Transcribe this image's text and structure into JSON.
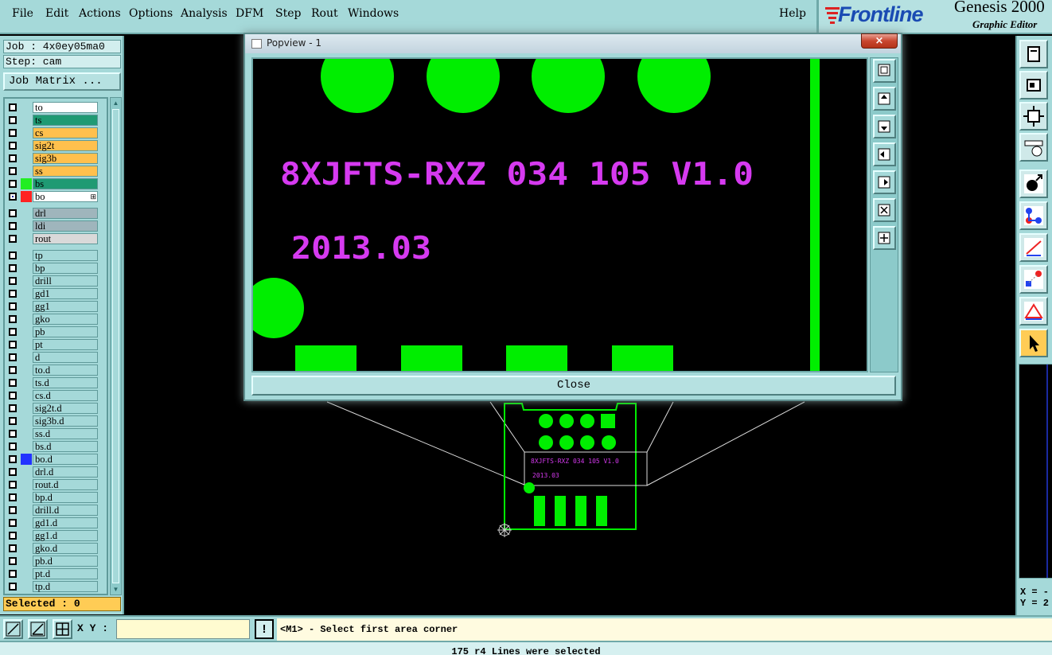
{
  "menu": {
    "file": "File",
    "edit": "Edit",
    "actions": "Actions",
    "options": "Options",
    "analysis": "Analysis",
    "dfm": "DFM",
    "step": "Step",
    "rout": "Rout",
    "windows": "Windows",
    "help": "Help"
  },
  "brand": {
    "logo": "Frontline",
    "title": "Genesis 2000",
    "subtitle": "Graphic Editor"
  },
  "job": {
    "job_label": "Job : 4x0ey05ma0",
    "step_label": "Step: cam",
    "matrix_button": "Job Matrix ..."
  },
  "layers": [
    {
      "name": "to",
      "bg": "#ffffff",
      "swatch": "none",
      "checked": false
    },
    {
      "name": "ts",
      "bg": "#1f9a73",
      "swatch": "none",
      "checked": false
    },
    {
      "name": "cs",
      "bg": "#ffc04d",
      "swatch": "none",
      "checked": false
    },
    {
      "name": "sig2t",
      "bg": "#ffc04d",
      "swatch": "none",
      "checked": false
    },
    {
      "name": "sig3b",
      "bg": "#ffc04d",
      "swatch": "none",
      "checked": false
    },
    {
      "name": "ss",
      "bg": "#ffc04d",
      "swatch": "none",
      "checked": false
    },
    {
      "name": "bs",
      "bg": "#1f9a73",
      "swatch": "#22ee22",
      "checked": false
    },
    {
      "name": "bo",
      "bg": "#ffffff",
      "swatch": "#ff2222",
      "checked": true,
      "work": true
    },
    {
      "name": "drl",
      "bg": "#9fb5bc",
      "swatch": "none",
      "checked": false,
      "gap": true
    },
    {
      "name": "ldi",
      "bg": "#9fb5bc",
      "swatch": "none",
      "checked": false
    },
    {
      "name": "rout",
      "bg": "#d9d9d9",
      "swatch": "none",
      "checked": false
    },
    {
      "name": "tp",
      "bg": "#a5d9d9",
      "swatch": "none",
      "checked": false,
      "gap": true
    },
    {
      "name": "bp",
      "bg": "#a5d9d9",
      "swatch": "none",
      "checked": false
    },
    {
      "name": "drill",
      "bg": "#a5d9d9",
      "swatch": "none",
      "checked": false
    },
    {
      "name": "gd1",
      "bg": "#a5d9d9",
      "swatch": "none",
      "checked": false
    },
    {
      "name": "gg1",
      "bg": "#a5d9d9",
      "swatch": "none",
      "checked": false
    },
    {
      "name": "gko",
      "bg": "#a5d9d9",
      "swatch": "none",
      "checked": false
    },
    {
      "name": "pb",
      "bg": "#a5d9d9",
      "swatch": "none",
      "checked": false
    },
    {
      "name": "pt",
      "bg": "#a5d9d9",
      "swatch": "none",
      "checked": false
    },
    {
      "name": "d",
      "bg": "#a5d9d9",
      "swatch": "none",
      "checked": false
    },
    {
      "name": "to.d",
      "bg": "#a5d9d9",
      "swatch": "none",
      "checked": false
    },
    {
      "name": "ts.d",
      "bg": "#a5d9d9",
      "swatch": "none",
      "checked": false
    },
    {
      "name": "cs.d",
      "bg": "#a5d9d9",
      "swatch": "none",
      "checked": false
    },
    {
      "name": "sig2t.d",
      "bg": "#a5d9d9",
      "swatch": "none",
      "checked": false
    },
    {
      "name": "sig3b.d",
      "bg": "#a5d9d9",
      "swatch": "none",
      "checked": false
    },
    {
      "name": "ss.d",
      "bg": "#a5d9d9",
      "swatch": "none",
      "checked": false
    },
    {
      "name": "bs.d",
      "bg": "#a5d9d9",
      "swatch": "none",
      "checked": false
    },
    {
      "name": "bo.d",
      "bg": "#a5d9d9",
      "swatch": "#2233ff",
      "checked": false
    },
    {
      "name": "drl.d",
      "bg": "#a5d9d9",
      "swatch": "none",
      "checked": false
    },
    {
      "name": "rout.d",
      "bg": "#a5d9d9",
      "swatch": "none",
      "checked": false
    },
    {
      "name": "bp.d",
      "bg": "#a5d9d9",
      "swatch": "none",
      "checked": false
    },
    {
      "name": "drill.d",
      "bg": "#a5d9d9",
      "swatch": "none",
      "checked": false
    },
    {
      "name": "gd1.d",
      "bg": "#a5d9d9",
      "swatch": "none",
      "checked": false
    },
    {
      "name": "gg1.d",
      "bg": "#a5d9d9",
      "swatch": "none",
      "checked": false
    },
    {
      "name": "gko.d",
      "bg": "#a5d9d9",
      "swatch": "none",
      "checked": false
    },
    {
      "name": "pb.d",
      "bg": "#a5d9d9",
      "swatch": "none",
      "checked": false
    },
    {
      "name": "pt.d",
      "bg": "#a5d9d9",
      "swatch": "none",
      "checked": false
    },
    {
      "name": "tp.d",
      "bg": "#a5d9d9",
      "swatch": "none",
      "checked": false
    }
  ],
  "selected_label": "Selected : 0",
  "command_bar": {
    "xy_label": "X Y :",
    "xy_value": "",
    "prompt": "<M1> - Select first area corner"
  },
  "status": "175 r4 Lines were selected",
  "coords": {
    "x": "X = -",
    "y": "Y = 2"
  },
  "popview": {
    "title": "Popview - 1",
    "close_x": "×",
    "close_label": "Close",
    "text_line1": "8XJFTS-RXZ 034 105 V1.0",
    "text_line2": "2013.03"
  },
  "board": {
    "text_line1": "8XJFTS-RXZ 034 105 V1.0",
    "text_line2": "2013.03"
  },
  "colors": {
    "pad_green": "#00ee00",
    "text_magenta": "#d63af0",
    "panel_teal": "#a5d9d9",
    "selected_orange": "#ffcc55"
  }
}
